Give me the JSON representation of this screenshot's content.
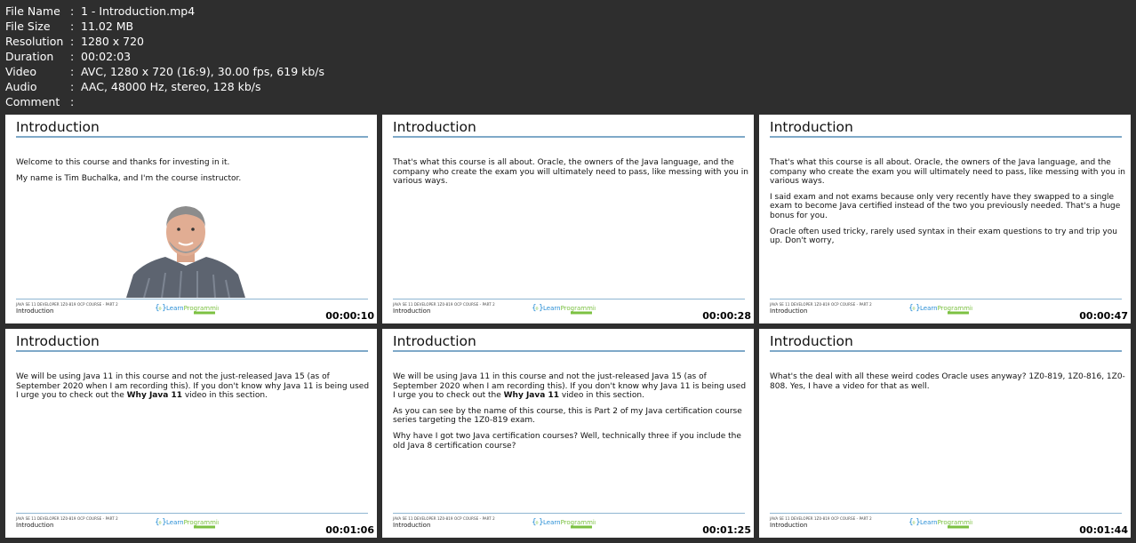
{
  "meta": {
    "rows": [
      {
        "key": "File Name",
        "value": "1 - Introduction.mp4"
      },
      {
        "key": "File Size",
        "value": "11.02 MB"
      },
      {
        "key": "Resolution",
        "value": "1280 x 720"
      },
      {
        "key": "Duration",
        "value": "00:02:03"
      },
      {
        "key": "Video",
        "value": "AVC, 1280 x 720 (16:9), 30.00 fps, 619 kb/s"
      },
      {
        "key": "Audio",
        "value": "AAC, 48000 Hz, stereo, 128 kb/s"
      },
      {
        "key": "Comment",
        "value": ""
      }
    ]
  },
  "slide_common": {
    "course_label": "JAVA SE 11 DEVELOPER 1Z0-819 OCP COURSE - PART 2",
    "section_label": "Introduction",
    "logo_text_a": "Learn",
    "logo_text_b": "Programming",
    "logo_sub": "ACADEMY",
    "colors": {
      "rule": "#7fa9c8",
      "logo_blue": "#2a8fd6",
      "logo_green": "#7cc142"
    }
  },
  "thumbs": [
    {
      "title": "Introduction",
      "timestamp": "00:00:10",
      "p1": "Welcome to this course and thanks for investing in it.",
      "p2": "My name is Tim Buchalka, and I'm the course instructor."
    },
    {
      "title": "Introduction",
      "timestamp": "00:00:28",
      "p1": "That's what this course is all about. Oracle, the owners of the Java language, and the company who create the exam you will ultimately need to pass, like messing with you in various ways."
    },
    {
      "title": "Introduction",
      "timestamp": "00:00:47",
      "p1": "That's what this course is all about. Oracle, the owners of the Java language, and the company who create the exam you will ultimately need to pass, like messing with you in various ways.",
      "p2": "I said exam and not exams because only very recently have they swapped to a single exam to become Java certified instead of the two you previously needed. That's a huge bonus for you.",
      "p3": "Oracle often used tricky, rarely used syntax in their exam questions to try and trip you up. Don't worry,"
    },
    {
      "title": "Introduction",
      "timestamp": "00:01:06",
      "p1a": "We will be using Java 11 in this course and not the just-released Java 15 (as of September 2020 when I am recording this). If you don't know why Java 11 is being used I urge you to check out the ",
      "p1b": "Why Java 11",
      "p1c": " video in this section."
    },
    {
      "title": "Introduction",
      "timestamp": "00:01:25",
      "p1a": "We will be using Java 11 in this course and not the just-released Java 15 (as of September 2020 when I am recording this). If you don't know why Java 11 is being used I urge you to check out the ",
      "p1b": "Why Java 11",
      "p1c": " video in this section.",
      "p2": "As you can see by the name of this course, this is Part 2 of my Java certification course series targeting the 1Z0-819 exam.",
      "p3": "Why have I got two Java certification courses? Well, technically three if you include the old Java 8 certification course?"
    },
    {
      "title": "Introduction",
      "timestamp": "00:01:44",
      "p1": "What's the deal with all these weird codes Oracle uses anyway? 1Z0-819, 1Z0-816, 1Z0-808. Yes, I have a video for that as well."
    }
  ]
}
